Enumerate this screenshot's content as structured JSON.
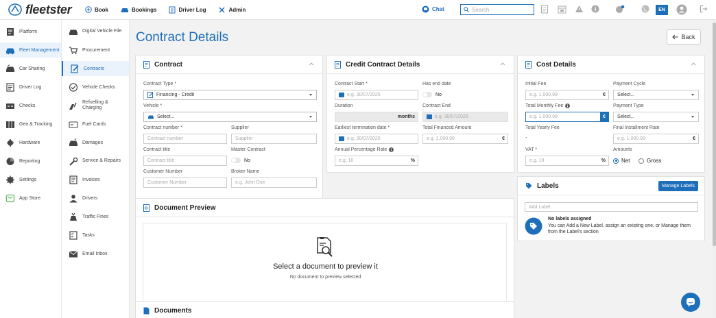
{
  "brand": {
    "name": "fleetster",
    "accent": "#1e6fb9"
  },
  "topnav": {
    "book": "Book",
    "bookings": "Bookings",
    "driver_log": "Driver Log",
    "admin": "Admin",
    "chat": "Chat",
    "search_placeholder": "Search",
    "language": "EN"
  },
  "sidebar_primary": [
    {
      "label": "Platform",
      "icon": "platform-icon"
    },
    {
      "label": "Fleet Management",
      "icon": "car-icon",
      "active": true
    },
    {
      "label": "Car Sharing",
      "icon": "car-sharing-icon"
    },
    {
      "label": "Driver Log",
      "icon": "driver-log-icon"
    },
    {
      "label": "Checks",
      "icon": "checks-icon"
    },
    {
      "label": "Geo & Tracking",
      "icon": "geo-icon"
    },
    {
      "label": "Hardware",
      "icon": "hardware-icon"
    },
    {
      "label": "Reporting",
      "icon": "reporting-icon"
    },
    {
      "label": "Settings",
      "icon": "settings-icon"
    },
    {
      "label": "App Store",
      "icon": "app-store-icon"
    }
  ],
  "sidebar_secondary": [
    {
      "label": "Digital Vehicle File",
      "icon": "vehicle-file-icon"
    },
    {
      "label": "Procurement",
      "icon": "cart-icon"
    },
    {
      "label": "Contracts",
      "icon": "contracts-icon",
      "active": true
    },
    {
      "label": "Vehicle Checks",
      "icon": "vehicle-checks-icon"
    },
    {
      "label": "Refuelling & Charging",
      "icon": "refuel-icon"
    },
    {
      "label": "Fuel Cards",
      "icon": "fuel-card-icon"
    },
    {
      "label": "Damages",
      "icon": "damages-icon"
    },
    {
      "label": "Service & Repairs",
      "icon": "wrench-icon"
    },
    {
      "label": "Invoices",
      "icon": "invoices-icon"
    },
    {
      "label": "Drivers",
      "icon": "drivers-icon"
    },
    {
      "label": "Traffic Fines",
      "icon": "traffic-fines-icon"
    },
    {
      "label": "Tasks",
      "icon": "tasks-icon"
    },
    {
      "label": "Email Inbox",
      "icon": "email-icon"
    }
  ],
  "page": {
    "title": "Contract Details",
    "back": "Back"
  },
  "contract": {
    "title": "Contract",
    "contract_type_label": "Contract Type *",
    "contract_type_value": "Financing - Credit",
    "vehicle_label": "Vehicle *",
    "vehicle_value": "Select...",
    "contract_number_label": "Contract number *",
    "contract_number_placeholder": "Contract number",
    "supplier_label": "Supplier",
    "supplier_placeholder": "Supplier",
    "contract_title_label": "Contract title",
    "contract_title_placeholder": "Contract title",
    "master_contract_label": "Master Contract",
    "master_contract_value": "No",
    "customer_number_label": "Customer Number",
    "customer_number_placeholder": "Customer Number",
    "broker_name_label": "Broker Name",
    "broker_name_placeholder": "e.g. John Doe"
  },
  "credit": {
    "title": "Credit Contract Details",
    "contract_start_label": "Contract Start *",
    "contract_start_placeholder": "e.g. 30/07/2025",
    "has_end_date_label": "Has end date",
    "has_end_date_value": "No",
    "duration_label": "Duration",
    "duration_suffix": "months",
    "contract_end_label": "Contract End",
    "contract_end_placeholder": "e.g. 30/07/2025",
    "earliest_termination_label": "Earliest termination date *",
    "earliest_termination_placeholder": "e.g. 30/07/2025",
    "total_financed_label": "Total Financed Amount",
    "total_financed_placeholder": "e.g. 1,000.99",
    "total_financed_suffix": "€",
    "apr_label": "Annual Percentage Rate",
    "apr_placeholder": "e.g. 10",
    "apr_suffix": "%"
  },
  "cost": {
    "title": "Cost Details",
    "initial_fee_label": "Initial Fee",
    "initial_fee_placeholder": "e.g. 1,000.99",
    "initial_fee_suffix": "€",
    "payment_cycle_label": "Payment Cycle",
    "payment_cycle_value": "Select...",
    "total_monthly_fee_label": "Total Monthly Fee",
    "total_monthly_fee_placeholder": "e.g. 1,000.99",
    "total_monthly_fee_suffix": "€",
    "payment_type_label": "Payment Type",
    "payment_type_value": "Select...",
    "total_yearly_fee_label": "Total Yearly Fee",
    "total_yearly_fee_value": "-",
    "final_installment_label": "Final Installment Rate",
    "final_installment_placeholder": "e.g. 1,000.99",
    "final_installment_suffix": "€",
    "vat_label": "VAT *",
    "vat_placeholder": "e.g. 19",
    "vat_suffix": "%",
    "amounts_label": "Amounts",
    "amounts_net": "Net",
    "amounts_gross": "Gross",
    "amounts_selected": "Net"
  },
  "labels": {
    "title": "Labels",
    "manage_button": "Manage Labels",
    "add_placeholder": "Add Label",
    "empty_title": "No labels assigned",
    "empty_text": "You can Add a New Label, assign an existing one, or Manage them from the Label's section"
  },
  "preview": {
    "title": "Document Preview",
    "empty_title": "Select a document to preview it",
    "empty_text": "No document to preview selected"
  },
  "documents": {
    "title": "Documents"
  }
}
